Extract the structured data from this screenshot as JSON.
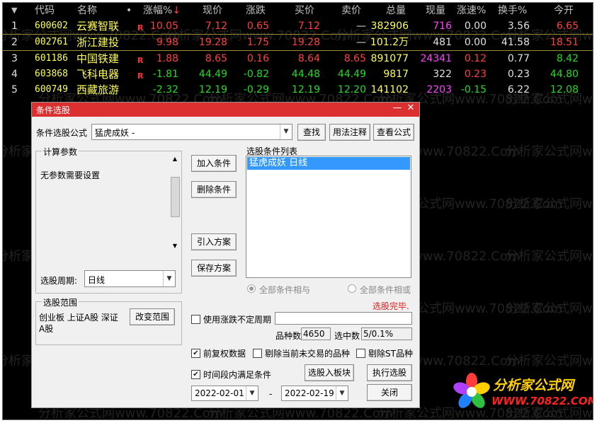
{
  "table": {
    "headers": [
      "代码",
      "名称",
      "•",
      "涨幅%",
      "现价",
      "涨跌",
      "买价",
      "卖价",
      "总量",
      "现量",
      "涨速%",
      "换手%",
      "今开"
    ],
    "sort_arrow": "↓",
    "rows": [
      {
        "idx": "1",
        "code": "600602",
        "name": "云赛智联",
        "badge": "R",
        "change_pct": "10.05",
        "price": "7.12",
        "change": "0.65",
        "bid": "7.12",
        "ask": "—",
        "volume": "382906",
        "cur_vol": "716",
        "speed": "0.00",
        "turnover": "3.56",
        "open": "6.65"
      },
      {
        "idx": "2",
        "code": "002761",
        "name": "浙江建投",
        "badge": "",
        "change_pct": "9.98",
        "price": "19.28",
        "change": "1.75",
        "bid": "19.28",
        "ask": "—",
        "volume": "101.2万",
        "cur_vol": "481",
        "speed": "0.00",
        "turnover": "41.58",
        "open": "18.51"
      },
      {
        "idx": "3",
        "code": "601186",
        "name": "中国铁建",
        "badge": "R",
        "change_pct": "1.88",
        "price": "8.65",
        "change": "0.16",
        "bid": "8.64",
        "ask": "8.65",
        "volume": "891077",
        "cur_vol": "24341",
        "speed": "0.12",
        "turnover": "0.77",
        "open": "8.42"
      },
      {
        "idx": "4",
        "code": "603868",
        "name": "飞科电器",
        "badge": "R",
        "change_pct": "-1.81",
        "price": "44.49",
        "change": "-0.82",
        "bid": "44.48",
        "ask": "44.49",
        "volume": "9817",
        "cur_vol": "322",
        "speed": "0.23",
        "turnover": "0.23",
        "open": "44.80"
      },
      {
        "idx": "5",
        "code": "600749",
        "name": "西藏旅游",
        "badge": "",
        "change_pct": "-2.32",
        "price": "12.19",
        "change": "-0.29",
        "bid": "12.19",
        "ask": "12.20",
        "volume": "141102",
        "cur_vol": "2203",
        "speed": "-0.15",
        "turnover": "6.22",
        "open": "12.08"
      }
    ]
  },
  "watermark": "分析家公式网www.70822.Com",
  "dialog": {
    "title": "条件选股",
    "minimize": "—",
    "close": "✕",
    "formula_label": "条件选股公式",
    "formula_value": "猛虎成妖    -",
    "find_button": "查找",
    "usage_button": "用法注释",
    "view_formula_button": "查看公式",
    "params_group_title": "计算参数",
    "params_text": "无参数需要设置",
    "period_label": "选股周期:",
    "period_value": "日线",
    "add_condition": "加入条件",
    "delete_condition": "删除条件",
    "import_plan": "引入方案",
    "save_plan": "保存方案",
    "condition_list_label": "选股条件列表",
    "conditions": [
      "猛虎成妖  日线"
    ],
    "radio_and": "全部条件相与",
    "radio_or": "全部条件相或",
    "status": "选股完毕.",
    "range_group_title": "选股范围",
    "range_text": "创业板 上证A股 深证A股",
    "change_range": "改变范围",
    "use_variable_period": "使用涨跌不定周期",
    "stock_count_label": "品种数",
    "stock_count": "4650",
    "selected_label": "选中数",
    "selected_value": "5/0.1%",
    "pre_adjusted": "前复权数据",
    "exclude_untraded": "剔除当前未交易的品种",
    "exclude_st": "剔除ST品种",
    "time_range": "时间段内满足条件",
    "to_board": "选股入板块",
    "execute": "执行选股",
    "close_button": "关闭",
    "start_date": "2022-02-01",
    "date_sep": "-",
    "end_date": "2022-02-19"
  },
  "logo": {
    "title": "分析家公式网",
    "url": "WWW.70822.COM"
  },
  "colors": {
    "title_bar": "#dc3030",
    "selection": "#3399ff",
    "up": "#ff4040",
    "down": "#22dd22"
  }
}
